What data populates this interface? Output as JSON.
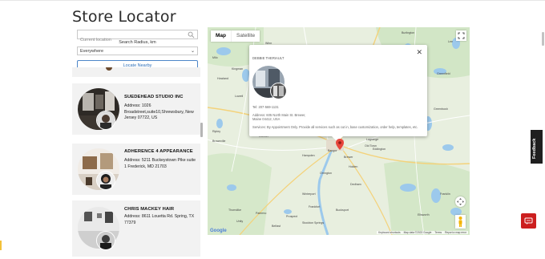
{
  "page": {
    "title": "Store Locator"
  },
  "search": {
    "placeholder": "Current location",
    "radius_label": "Search Radius, km",
    "radius_value": "Everywhere",
    "locate_button": "Locate Nearby"
  },
  "stores": [
    {
      "name": "SUEDEHEAD STUDIO INC",
      "address": "Address: 1026 Broadstreet,suite10,Shrewsbury, New Jersey 07722, US"
    },
    {
      "name": "ADHERENCE 4 APPEARANCE",
      "address": "Address: 5211 Buckeystown Pike suite 1 Frederick, MD 21703"
    },
    {
      "name": "CHRIS MACKEY HAIR",
      "address": "Address: 8611 Louetta Rd. Spring, TX 77379"
    }
  ],
  "map": {
    "type_map": "Map",
    "type_satellite": "Satellite",
    "infowindow": {
      "title": "DEBBIE THERIAULT",
      "tel": "Tel: 207-569-1131",
      "address": "Address: 605 North Main St. Brewer, Maine 04412, USA",
      "services": "Services: By Appointment Only. Provide all services such as cut in, base customization, order help, templates, etc."
    },
    "labels": [
      "Burlington",
      "Lee",
      "Greenfield",
      "Winn",
      "Kingman",
      "Greenbush",
      "Lowell",
      "Howland",
      "Milo",
      "Brownville",
      "Ripley",
      "Lagrange",
      "Corinth",
      "Alton",
      "Old Town",
      "Hampden",
      "Bangor",
      "Brewer",
      "Eddington",
      "Holden",
      "Dedham",
      "Orrington",
      "Winterport",
      "Bucksport",
      "Frankfort",
      "Ellsworth",
      "Belfast",
      "Prospect",
      "Stockton Springs",
      "Franklin",
      "Thorndike",
      "Unity",
      "Palermo"
    ],
    "footer": [
      "Keyboard shortcuts",
      "Map data ©2023 Google",
      "Terms",
      "Report a map error"
    ],
    "logo": "Google"
  },
  "feedback_label": "Feedback",
  "colors": {
    "accent": "#2d6fb8",
    "pin": "#e8453c",
    "chat": "#cc1f1f"
  }
}
